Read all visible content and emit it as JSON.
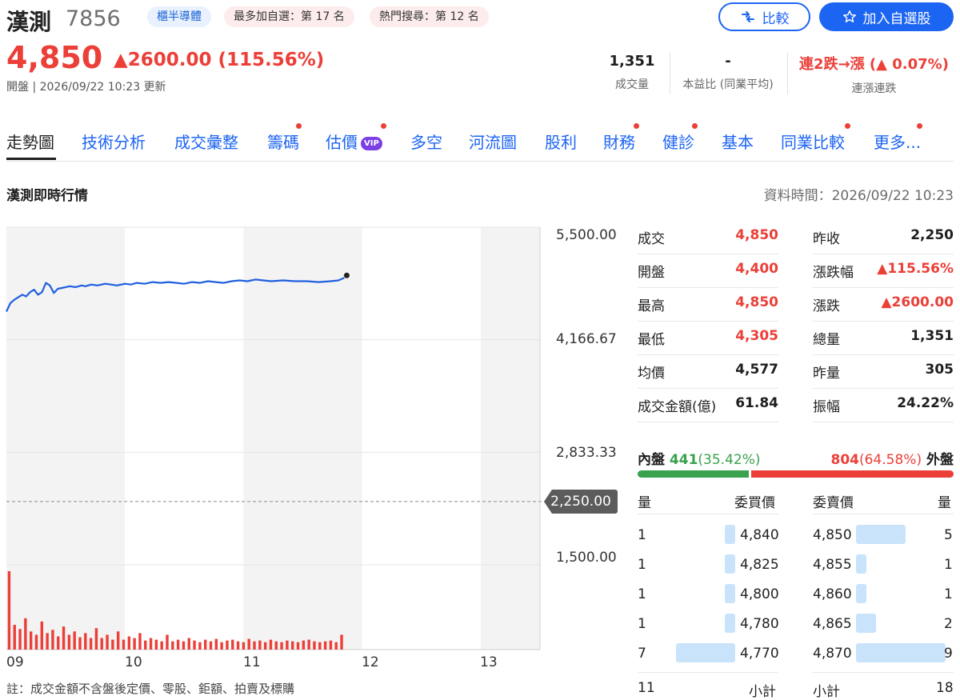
{
  "stock": {
    "name": "漢測",
    "code": "7856",
    "price": "4,850",
    "change": "▲2600.00 (115.56%)",
    "status": "開盤 | 2026/09/22 10:23 更新"
  },
  "chips": [
    "櫃半導體",
    "最多加自選：第 17 名",
    "熱門搜尋：第 12 名"
  ],
  "buttons": {
    "compare": "比較",
    "watchlist": "加入自選股"
  },
  "stats": [
    {
      "value": "1,351",
      "label": "成交量"
    },
    {
      "value": "-",
      "label": "本益比 (同業平均)"
    },
    {
      "value": "連2跌→漲 (▲ 0.07%)",
      "label": "連漲連跌"
    }
  ],
  "tabs": [
    {
      "label": "走勢圖",
      "dot": false
    },
    {
      "label": "技術分析",
      "dot": false
    },
    {
      "label": "成交彙整",
      "dot": false
    },
    {
      "label": "籌碼",
      "dot": true
    },
    {
      "label": "估價",
      "dot": true,
      "badge": "VIP"
    },
    {
      "label": "多空",
      "dot": false
    },
    {
      "label": "河流圖",
      "dot": false
    },
    {
      "label": "股利",
      "dot": false
    },
    {
      "label": "財務",
      "dot": true
    },
    {
      "label": "健診",
      "dot": true
    },
    {
      "label": "基本",
      "dot": false
    },
    {
      "label": "同業比較",
      "dot": true
    },
    {
      "label": "更多...",
      "dot": true
    }
  ],
  "section": {
    "title": "漢測即時行情",
    "time": "資料時間：2026/09/22 10:23"
  },
  "chart_data": {
    "type": "line",
    "y_ticks": [
      "5,500.00",
      "4,166.67",
      "2,833.33",
      "1,500.00"
    ],
    "ylim": [
      1500,
      5500
    ],
    "reference": {
      "value": 2250,
      "label": "2,250.00"
    },
    "x_ticks": [
      "09",
      "10",
      "11",
      "12",
      "13"
    ],
    "x_range_minutes": [
      0,
      270
    ],
    "series": [
      {
        "values": [
          [
            0,
            4500
          ],
          [
            2,
            4600
          ],
          [
            4,
            4640
          ],
          [
            6,
            4670
          ],
          [
            8,
            4700
          ],
          [
            10,
            4680
          ],
          [
            12,
            4730
          ],
          [
            14,
            4760
          ],
          [
            16,
            4700
          ],
          [
            18,
            4730
          ],
          [
            20,
            4840
          ],
          [
            22,
            4810
          ],
          [
            24,
            4720
          ],
          [
            26,
            4770
          ],
          [
            28,
            4780
          ],
          [
            30,
            4790
          ],
          [
            32,
            4800
          ],
          [
            35,
            4790
          ],
          [
            38,
            4810
          ],
          [
            40,
            4800
          ],
          [
            43,
            4820
          ],
          [
            46,
            4810
          ],
          [
            50,
            4830
          ],
          [
            53,
            4820
          ],
          [
            56,
            4810
          ],
          [
            60,
            4830
          ],
          [
            63,
            4820
          ],
          [
            66,
            4840
          ],
          [
            70,
            4830
          ],
          [
            74,
            4850
          ],
          [
            78,
            4840
          ],
          [
            82,
            4850
          ],
          [
            86,
            4840
          ],
          [
            90,
            4830
          ],
          [
            94,
            4850
          ],
          [
            98,
            4840
          ],
          [
            102,
            4860
          ],
          [
            106,
            4850
          ],
          [
            110,
            4840
          ],
          [
            114,
            4860
          ],
          [
            118,
            4870
          ],
          [
            122,
            4860
          ],
          [
            126,
            4880
          ],
          [
            130,
            4870
          ],
          [
            134,
            4860
          ],
          [
            140,
            4870
          ],
          [
            146,
            4860
          ],
          [
            152,
            4860
          ],
          [
            158,
            4850
          ],
          [
            164,
            4860
          ],
          [
            168,
            4870
          ],
          [
            171,
            4900
          ]
        ]
      }
    ],
    "volume": [
      95,
      30,
      25,
      38,
      22,
      18,
      34,
      20,
      24,
      16,
      28,
      18,
      22,
      15,
      20,
      14,
      26,
      14,
      18,
      12,
      22,
      12,
      16,
      14,
      20,
      11,
      14,
      12,
      10,
      18,
      10,
      12,
      10,
      14,
      11,
      9,
      12,
      10,
      13,
      9,
      11,
      12,
      10,
      9,
      13,
      10,
      11,
      9,
      12,
      10,
      9,
      11,
      10,
      9,
      11,
      12,
      10,
      9,
      10,
      11,
      9,
      18
    ],
    "volume_max": 95
  },
  "quote": {
    "left": [
      {
        "label": "成交",
        "value": "4,850",
        "color": "red"
      },
      {
        "label": "開盤",
        "value": "4,400",
        "color": "red"
      },
      {
        "label": "最高",
        "value": "4,850",
        "color": "red"
      },
      {
        "label": "最低",
        "value": "4,305",
        "color": "red"
      },
      {
        "label": "均價",
        "value": "4,577",
        "color": "black"
      },
      {
        "label": "成交金額(億)",
        "value": "61.84",
        "color": "black"
      }
    ],
    "right": [
      {
        "label": "昨收",
        "value": "2,250",
        "color": "black"
      },
      {
        "label": "漲跌幅",
        "value": "▲115.56%",
        "color": "red"
      },
      {
        "label": "漲跌",
        "value": "▲2600.00",
        "color": "red"
      },
      {
        "label": "總量",
        "value": "1,351",
        "color": "black"
      },
      {
        "label": "昨量",
        "value": "305",
        "color": "black"
      },
      {
        "label": "振幅",
        "value": "24.22%",
        "color": "black"
      }
    ]
  },
  "inout": {
    "inner_label": "內盤",
    "inner_count": "441",
    "inner_pct": "(35.42%)",
    "outer_count": "804",
    "outer_pct": "(64.58%)",
    "outer_label": "外盤",
    "inner_fraction": 0.3542
  },
  "orderbook": {
    "headers": [
      "量",
      "委買價",
      "委賣價",
      "量"
    ],
    "rows": [
      {
        "bid_qty": "1",
        "bid_price": "4,840",
        "ask_price": "4,850",
        "ask_qty": "5",
        "bid_n": 1,
        "ask_n": 5
      },
      {
        "bid_qty": "1",
        "bid_price": "4,825",
        "ask_price": "4,855",
        "ask_qty": "1",
        "bid_n": 1,
        "ask_n": 1
      },
      {
        "bid_qty": "1",
        "bid_price": "4,800",
        "ask_price": "4,860",
        "ask_qty": "1",
        "bid_n": 1,
        "ask_n": 1
      },
      {
        "bid_qty": "1",
        "bid_price": "4,780",
        "ask_price": "4,865",
        "ask_qty": "2",
        "bid_n": 1,
        "ask_n": 2
      },
      {
        "bid_qty": "7",
        "bid_price": "4,770",
        "ask_price": "4,870",
        "ask_qty": "9",
        "bid_n": 7,
        "ask_n": 9
      }
    ],
    "max_qty": 9,
    "subtotal_label": "小計",
    "bid_total": "11",
    "ask_total": "18"
  },
  "footnote": "註：成交金額不含盤後定價、零股、鉅額、拍賣及標購",
  "colors": {
    "up": "#eb3f38",
    "down": "#3aa14c",
    "line": "#1f5fe0",
    "accent": "#1c64f2"
  }
}
